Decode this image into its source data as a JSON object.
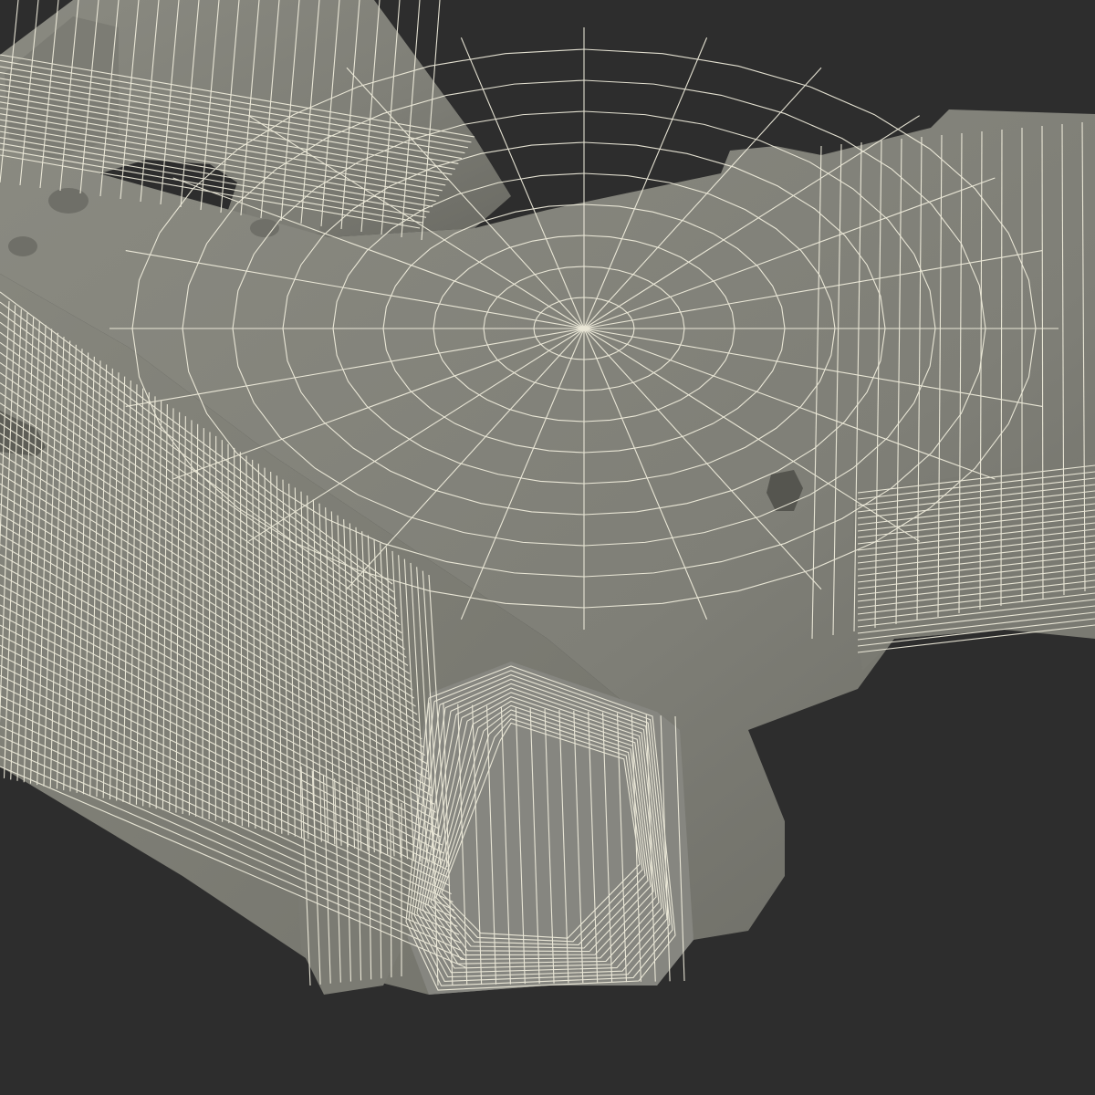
{
  "viewport": {
    "subject": "pistol-grip-wireframe-render",
    "background_color": "#2d2d2d",
    "surface_color": "#83837a",
    "surface_shadow_color": "#5f5f58",
    "wire_color": "#f3f0df"
  }
}
